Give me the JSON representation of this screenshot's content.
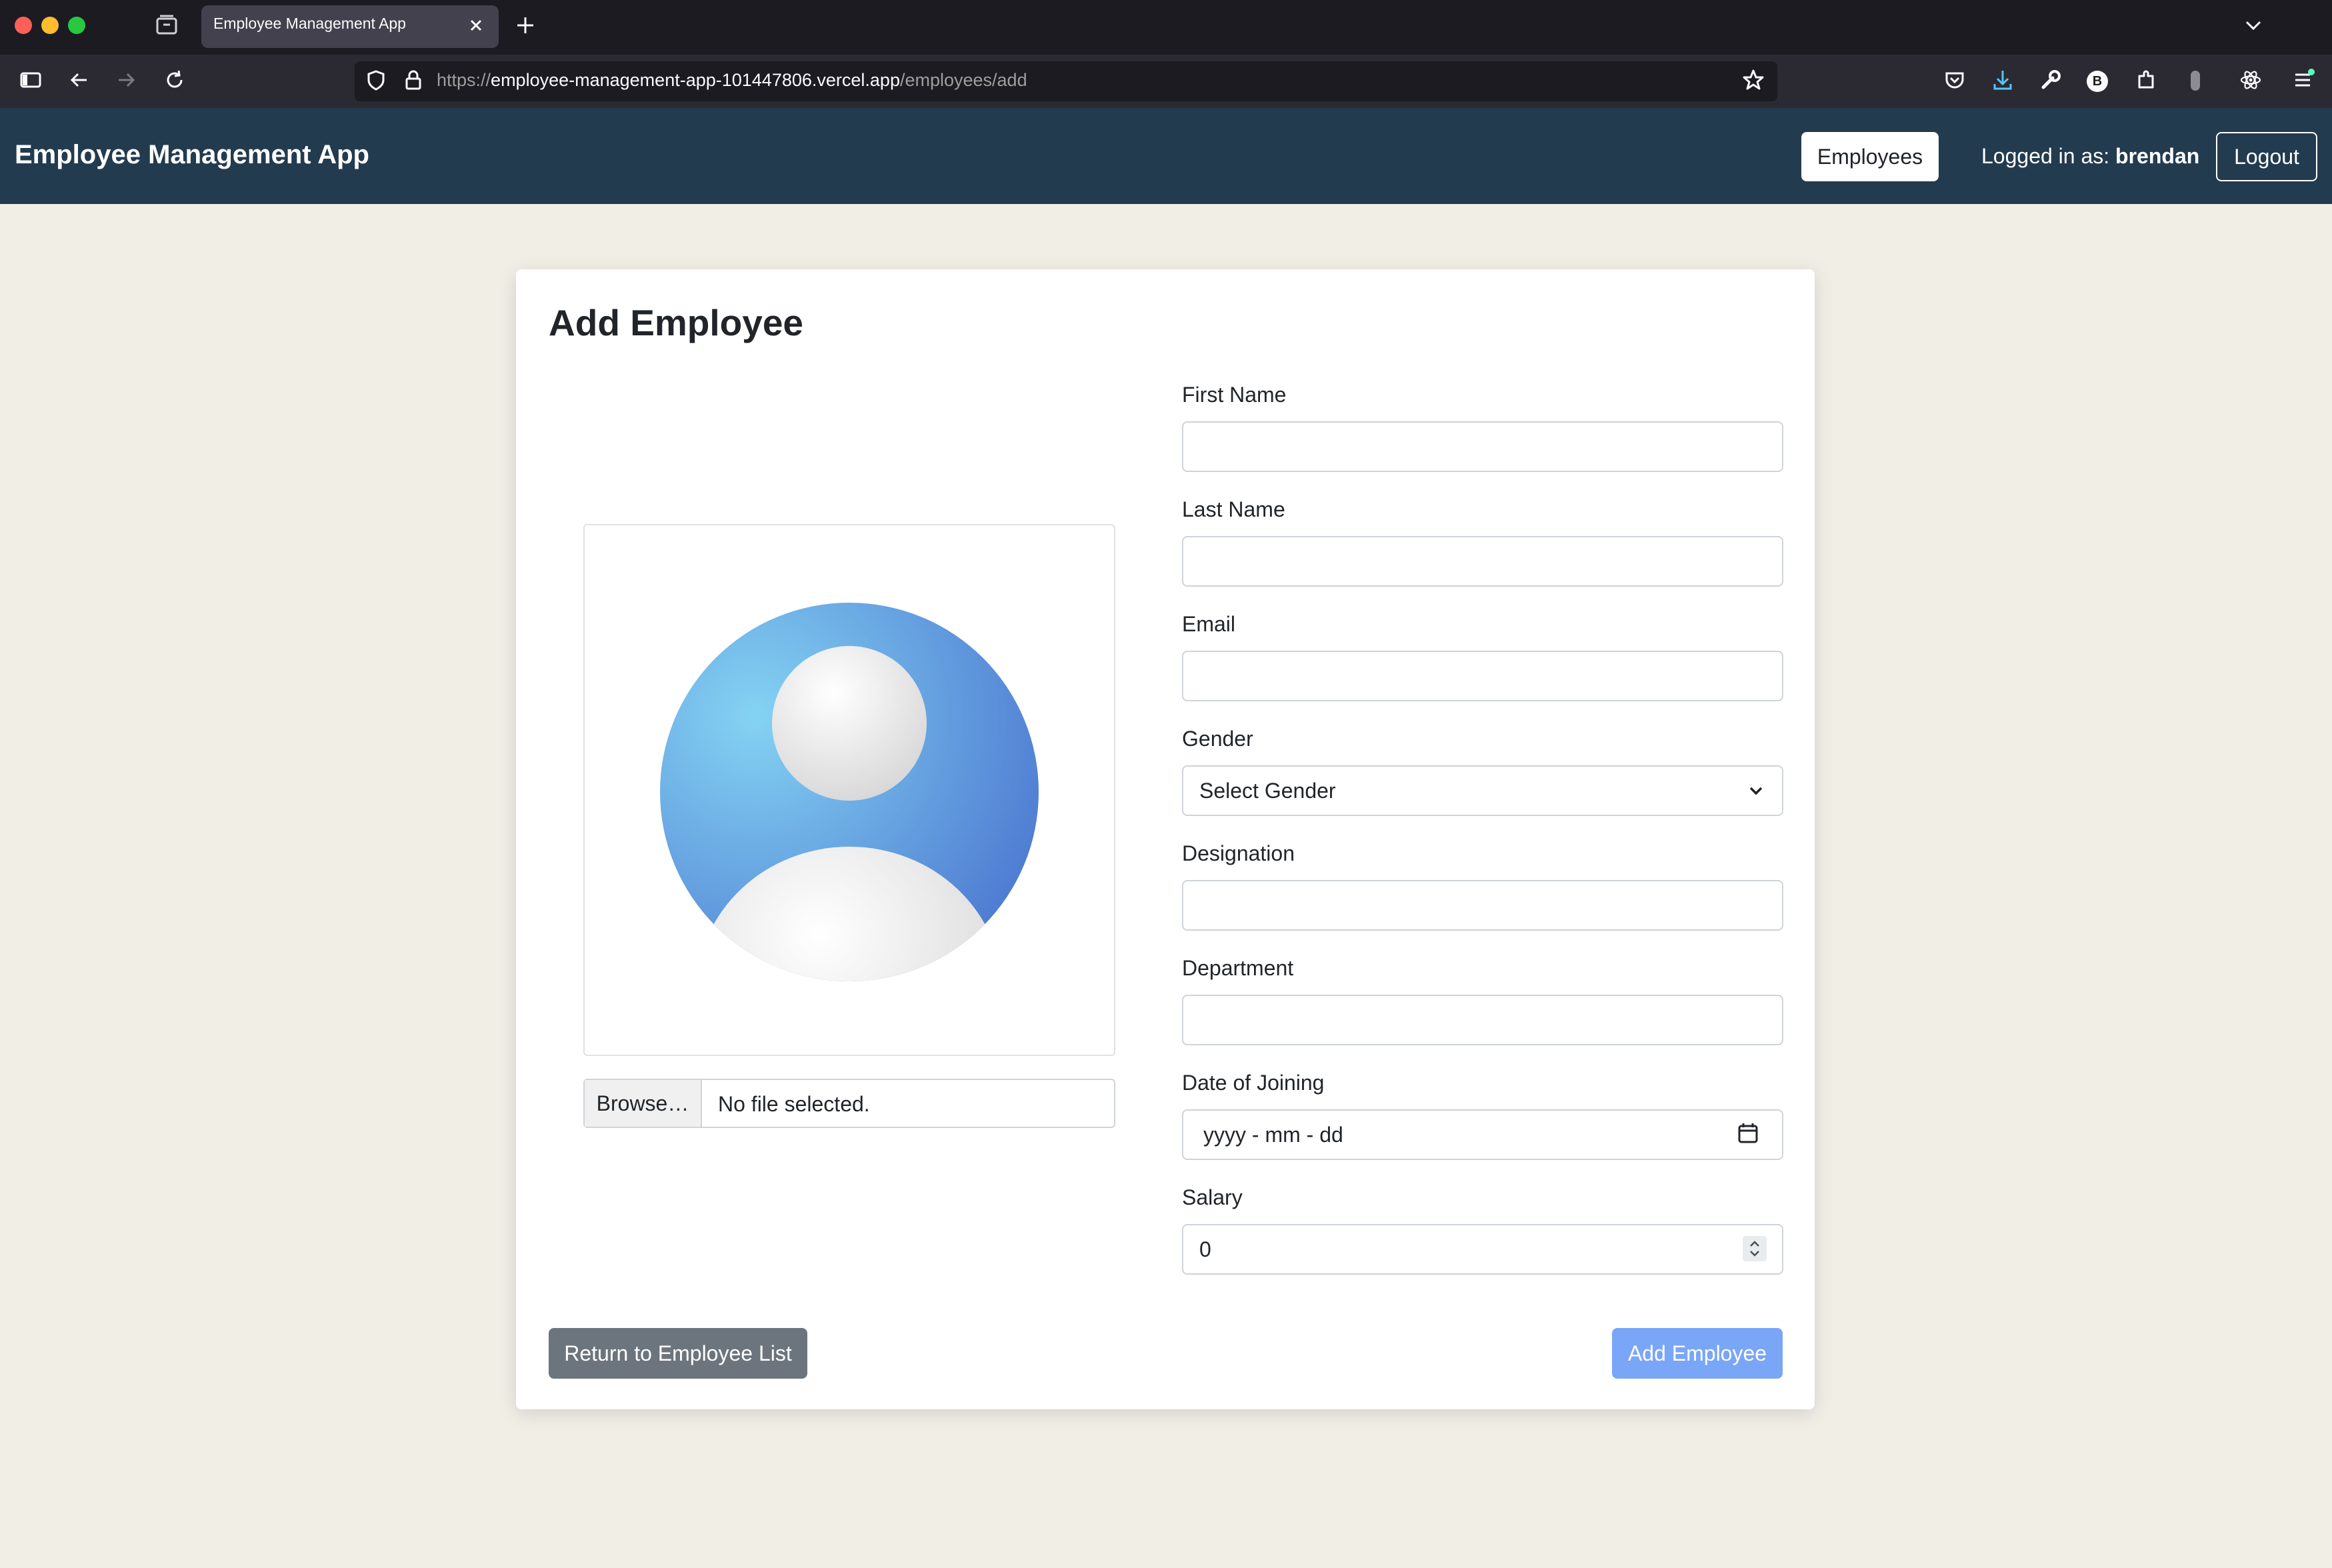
{
  "browser": {
    "tab_title": "Employee Management App",
    "url_scheme": "https://",
    "url_host": "employee-management-app-101447806.vercel.app",
    "url_path": "/employees/add",
    "profile_letter": "B"
  },
  "header": {
    "brand": "Employee Management App",
    "employees_label": "Employees",
    "logged_in_prefix": "Logged in as:",
    "username": "brendan",
    "logout_label": "Logout"
  },
  "form": {
    "title": "Add Employee",
    "photo": {
      "browse_label": "Browse…",
      "file_status": "No file selected."
    },
    "fields": {
      "first_name": {
        "label": "First Name",
        "value": ""
      },
      "last_name": {
        "label": "Last Name",
        "value": ""
      },
      "email": {
        "label": "Email",
        "value": ""
      },
      "gender": {
        "label": "Gender",
        "selected": "Select Gender"
      },
      "designation": {
        "label": "Designation",
        "value": ""
      },
      "department": {
        "label": "Department",
        "value": ""
      },
      "date_of_joining": {
        "label": "Date of Joining",
        "placeholder": "yyyy - mm - dd"
      },
      "salary": {
        "label": "Salary",
        "value": "0"
      }
    },
    "return_label": "Return to Employee List",
    "submit_label": "Add Employee"
  },
  "colors": {
    "app_header": "#233b4f",
    "page_background": "#f1eee6",
    "submit_button": "#7aa6f7",
    "return_button": "#6c757d"
  },
  "icons": {
    "sidebar": "sidebar-icon",
    "back": "back-arrow-icon",
    "forward": "forward-arrow-icon",
    "reload": "reload-icon",
    "shield": "shield-icon",
    "lock": "lock-icon",
    "bookmark": "star-icon",
    "pocket": "pocket-icon",
    "download": "download-icon",
    "tools": "wrench-icon",
    "extensions": "puzzle-icon",
    "react": "react-icon",
    "menu": "hamburger-menu-icon",
    "calendar": "calendar-icon",
    "select": "chevron-down-icon",
    "spinner": "spinner-icon",
    "avatar": "avatar-placeholder-icon"
  }
}
